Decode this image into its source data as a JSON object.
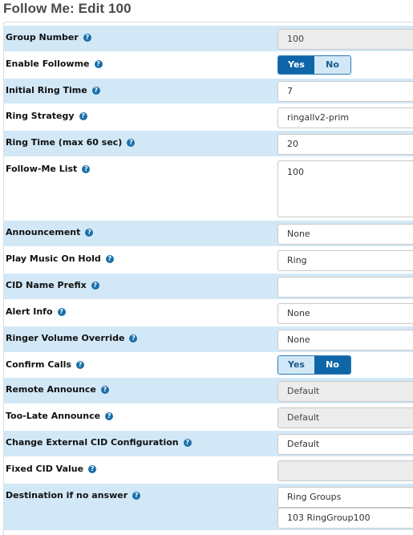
{
  "page": {
    "title": "Follow Me: Edit 100"
  },
  "colors": {
    "row_blue": "#d2e8f7",
    "toggle_active": "#0e66a8",
    "help_icon": "#1b6fa8"
  },
  "fields": {
    "group_number": {
      "label": "Group Number",
      "value": "100"
    },
    "enable_followme": {
      "label": "Enable Followme",
      "yes": "Yes",
      "no": "No",
      "selected": "Yes"
    },
    "initial_ring_time": {
      "label": "Initial Ring Time",
      "value": "7"
    },
    "ring_strategy": {
      "label": "Ring Strategy",
      "value": "ringallv2-prim"
    },
    "ring_time": {
      "label": "Ring Time (max 60 sec)",
      "value": "20"
    },
    "followme_list": {
      "label": "Follow-Me List",
      "value": "100"
    },
    "announcement": {
      "label": "Announcement",
      "value": "None"
    },
    "music_on_hold": {
      "label": "Play Music On Hold",
      "value": "Ring"
    },
    "cid_name_prefix": {
      "label": "CID Name Prefix",
      "value": ""
    },
    "alert_info": {
      "label": "Alert Info",
      "value": "None"
    },
    "ringer_volume": {
      "label": "Ringer Volume Override",
      "value": "None"
    },
    "confirm_calls": {
      "label": "Confirm Calls",
      "yes": "Yes",
      "no": "No",
      "selected": "No"
    },
    "remote_announce": {
      "label": "Remote Announce",
      "value": "Default"
    },
    "too_late_announce": {
      "label": "Too-Late Announce",
      "value": "Default"
    },
    "external_cid": {
      "label": "Change External CID Configuration",
      "value": "Default"
    },
    "fixed_cid": {
      "label": "Fixed CID Value",
      "value": ""
    },
    "destination": {
      "label": "Destination if no answer",
      "type_value": "Ring Groups",
      "target_value": "103 RingGroup100"
    }
  }
}
